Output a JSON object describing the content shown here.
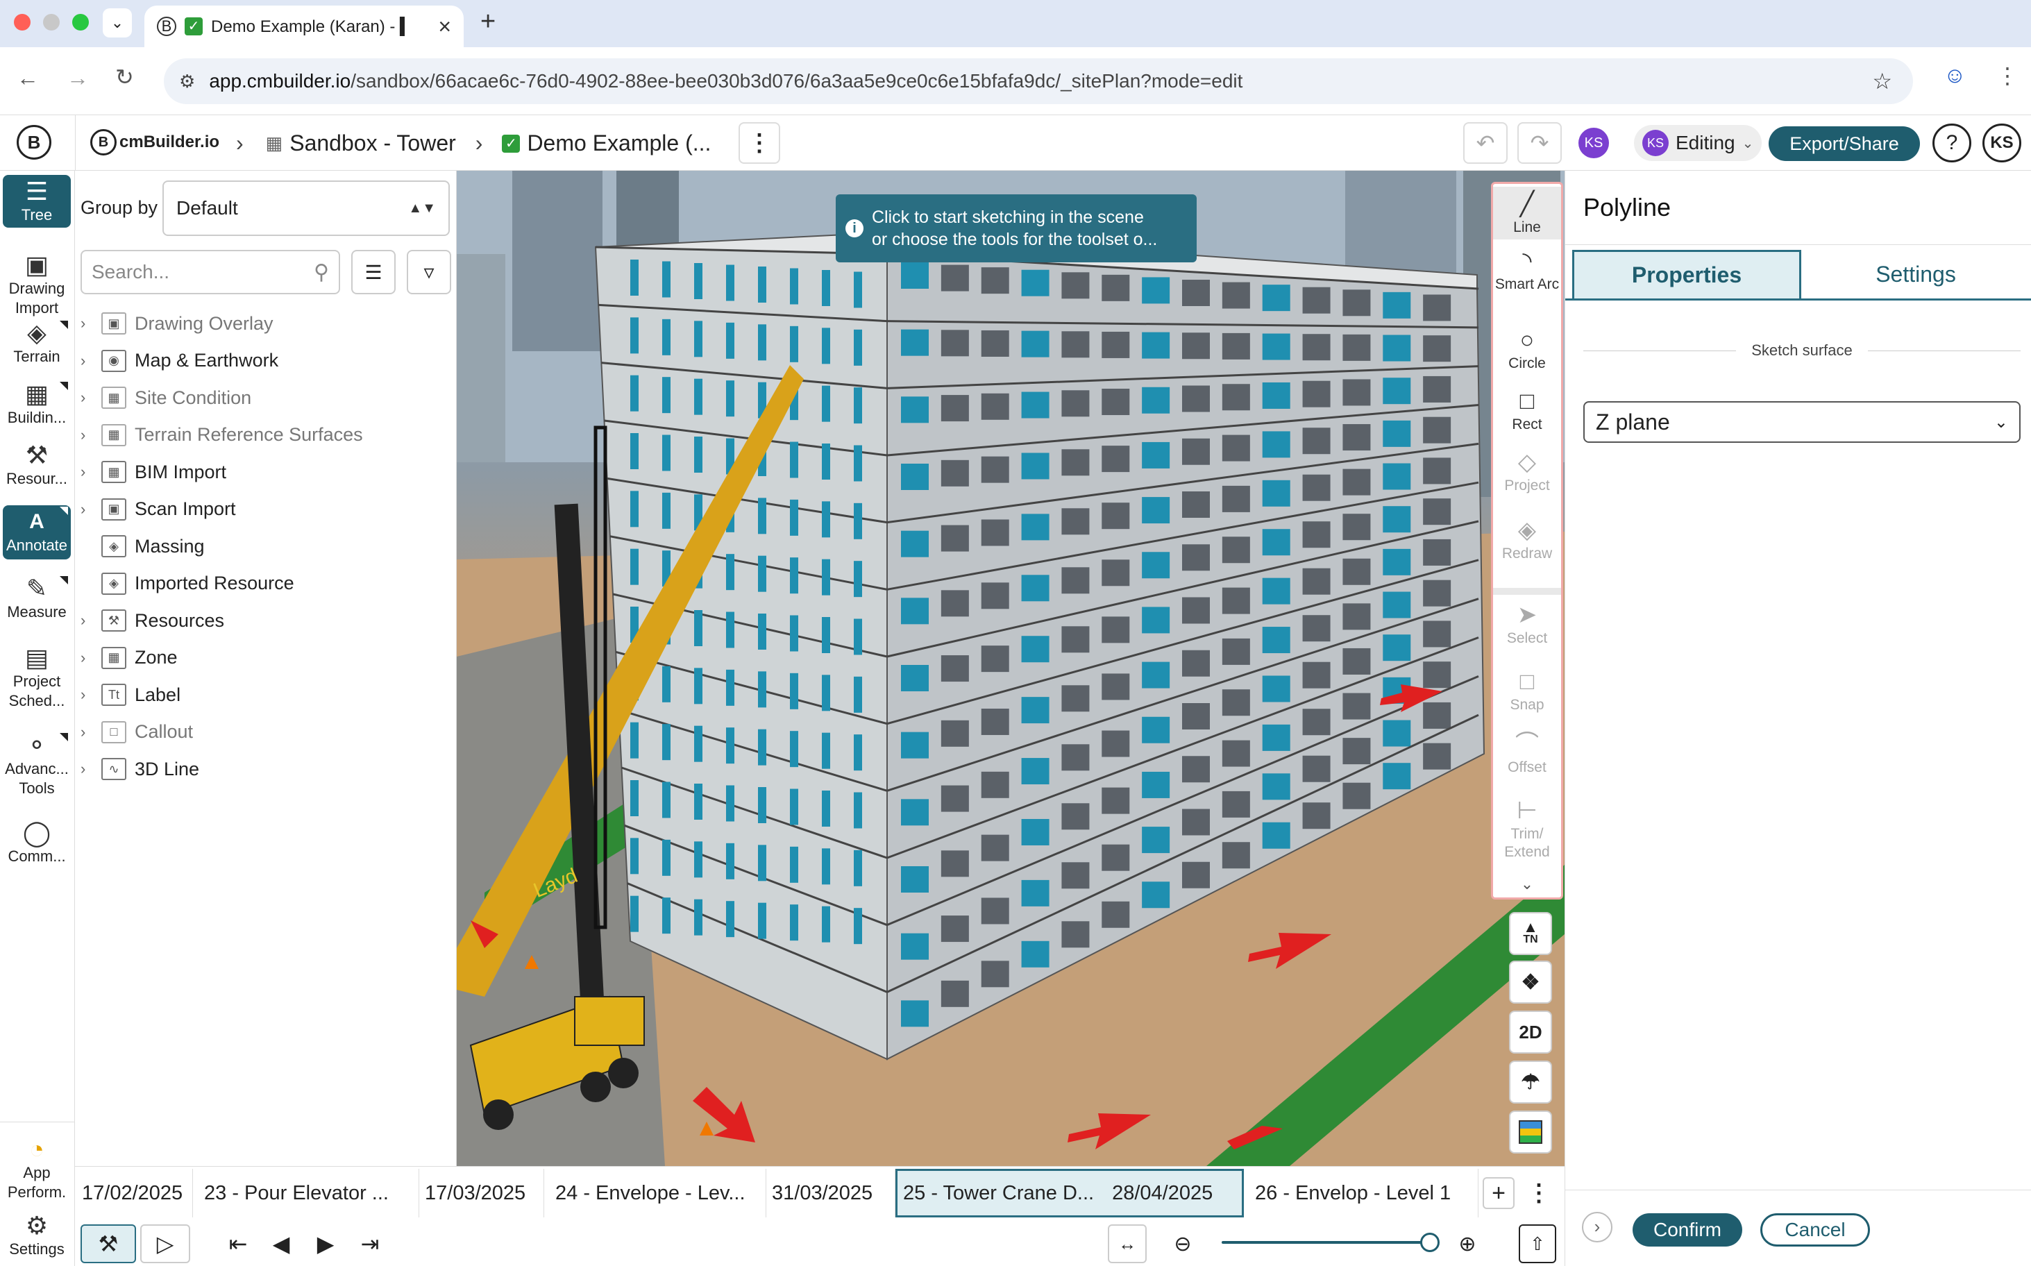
{
  "browser": {
    "tab_title": "Demo Example (Karan) - ▍",
    "url_host": "app.cmbuilder.io",
    "url_path": "/sandbox/66acae6c-76d0-4902-88ee-bee030b3d076/6a3aa5e9ce0c6e15bfafa9dc/_sitePlan?mode=edit"
  },
  "header": {
    "logo_text": "cmBuilder.io",
    "crumb_project": "Sandbox - Tower",
    "crumb_scene": "Demo Example (...",
    "avatar_initials": "KS",
    "editing_label": "Editing",
    "export_label": "Export/Share",
    "help_label": "?",
    "user_initials": "KS"
  },
  "rail": {
    "items": [
      {
        "label": "Tree"
      },
      {
        "label": "Drawing Import"
      },
      {
        "label": "Terrain"
      },
      {
        "label": "Buildin..."
      },
      {
        "label": "Resour..."
      },
      {
        "label": "Annotate"
      },
      {
        "label": "Measure"
      },
      {
        "label": "Project Sched..."
      },
      {
        "label": "Advanc... Tools"
      },
      {
        "label": "Comm..."
      }
    ],
    "bottom": [
      {
        "label": "App Perform."
      },
      {
        "label": "Settings"
      }
    ]
  },
  "tree": {
    "group_by_label": "Group by",
    "group_by_value": "Default",
    "search_placeholder": "Search...",
    "items": [
      {
        "label": "Drawing Overlay"
      },
      {
        "label": "Map & Earthwork"
      },
      {
        "label": "Site Condition"
      },
      {
        "label": "Terrain Reference Surfaces"
      },
      {
        "label": "BIM Import"
      },
      {
        "label": "Scan Import"
      },
      {
        "label": "Massing"
      },
      {
        "label": "Imported Resource"
      },
      {
        "label": "Resources"
      },
      {
        "label": "Zone"
      },
      {
        "label": "Label"
      },
      {
        "label": "Callout"
      },
      {
        "label": "3D Line"
      }
    ]
  },
  "viewport": {
    "tooltip_line1": "Click to start sketching in the scene",
    "tooltip_line2": "or choose the tools for the toolset o...",
    "ground_sign": "Layd"
  },
  "sketch_tools": {
    "line": "Line",
    "smart_arc": "Smart Arc",
    "circle": "Circle",
    "rect": "Rect",
    "project": "Project",
    "redraw": "Redraw",
    "select": "Select",
    "snap": "Snap",
    "offset": "Offset",
    "trim_extend": "Trim/ Extend",
    "north_label": "TN",
    "view_2d": "2D"
  },
  "right_panel": {
    "title": "Polyline",
    "tab_properties": "Properties",
    "tab_settings": "Settings",
    "section_label": "Sketch surface",
    "surface_value": "Z plane",
    "confirm_label": "Confirm",
    "cancel_label": "Cancel"
  },
  "timeline": {
    "segments": [
      {
        "date": "17/02/2025",
        "label": "23 - Pour Elevator ..."
      },
      {
        "date": "17/03/2025",
        "label": "24 - Envelope - Lev..."
      },
      {
        "date": "31/03/2025",
        "label": "25 - Tower Crane D..."
      },
      {
        "date": "28/04/2025",
        "label": "26 - Envelop - Level 1"
      }
    ],
    "slider_level": 1.0
  },
  "colors": {
    "accent": "#1f5d6e",
    "tooltip": "#2a6e82",
    "avatar": "#7b3fd0"
  }
}
